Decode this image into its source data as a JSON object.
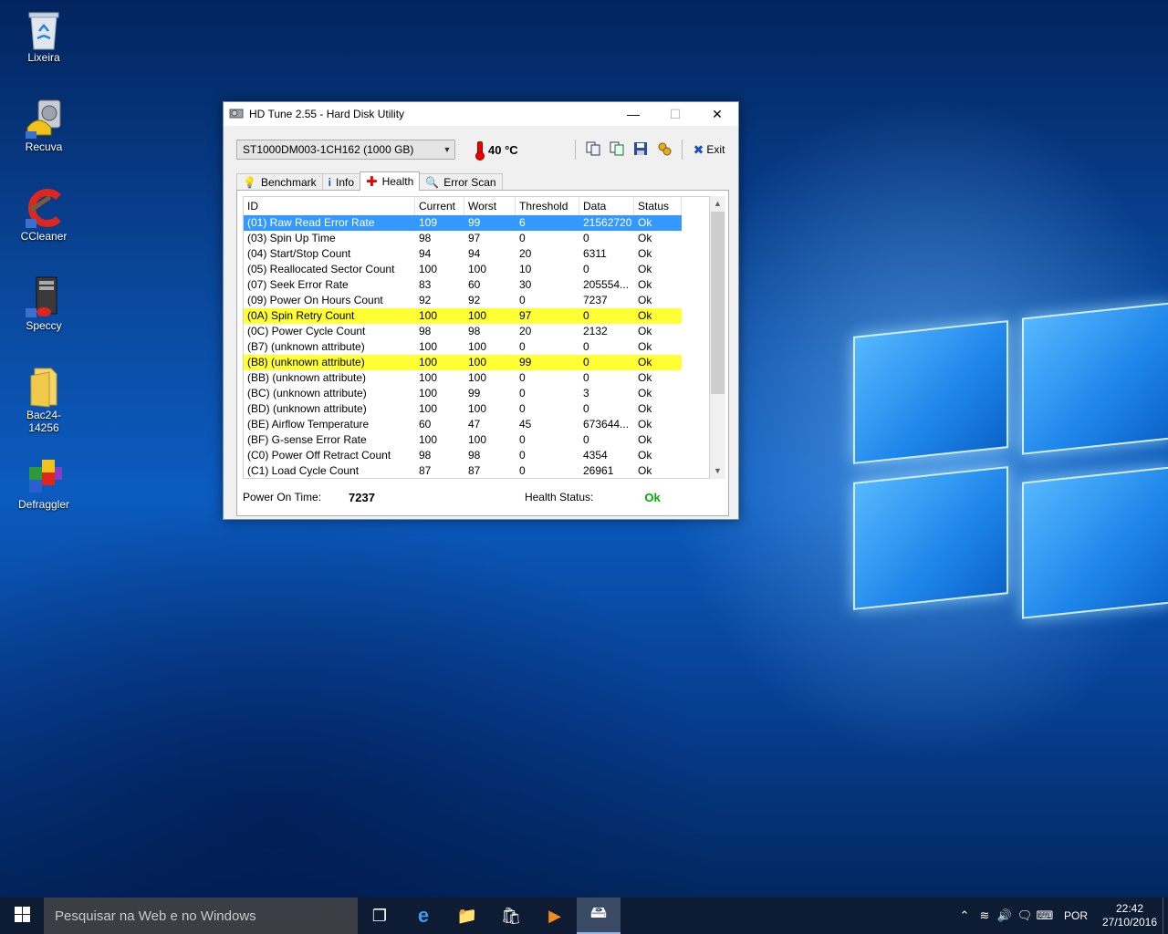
{
  "desktop": {
    "icons": [
      {
        "label": "Lixeira",
        "icon": "recycle-bin-icon"
      },
      {
        "label": "Recuva",
        "icon": "recuva-icon"
      },
      {
        "label": "CCleaner",
        "icon": "ccleaner-icon"
      },
      {
        "label": "Speccy",
        "icon": "speccy-icon"
      },
      {
        "label": "Bac24- 14256",
        "icon": "folder-icon"
      },
      {
        "label": "Defraggler",
        "icon": "defraggler-icon"
      }
    ]
  },
  "window": {
    "title": "HD Tune 2.55 - Hard Disk Utility",
    "drive": "ST1000DM003-1CH162 (1000 GB)",
    "temperature": "40 °C",
    "exit_label": "Exit",
    "tabs": [
      {
        "label": "Benchmark",
        "icon": "lightbulb-icon"
      },
      {
        "label": "Info",
        "icon": "info-icon"
      },
      {
        "label": "Health",
        "icon": "health-cross-icon",
        "active": true
      },
      {
        "label": "Error Scan",
        "icon": "magnifier-icon"
      }
    ],
    "columns": {
      "id": "ID",
      "current": "Current",
      "worst": "Worst",
      "threshold": "Threshold",
      "data": "Data",
      "status": "Status"
    },
    "rows": [
      {
        "id": "(01) Raw Read Error Rate",
        "current": "109",
        "worst": "99",
        "threshold": "6",
        "data": "21562720",
        "status": "Ok",
        "state": "selected"
      },
      {
        "id": "(03) Spin Up Time",
        "current": "98",
        "worst": "97",
        "threshold": "0",
        "data": "0",
        "status": "Ok",
        "state": ""
      },
      {
        "id": "(04) Start/Stop Count",
        "current": "94",
        "worst": "94",
        "threshold": "20",
        "data": "6311",
        "status": "Ok",
        "state": ""
      },
      {
        "id": "(05) Reallocated Sector Count",
        "current": "100",
        "worst": "100",
        "threshold": "10",
        "data": "0",
        "status": "Ok",
        "state": ""
      },
      {
        "id": "(07) Seek Error Rate",
        "current": "83",
        "worst": "60",
        "threshold": "30",
        "data": "205554...",
        "status": "Ok",
        "state": ""
      },
      {
        "id": "(09) Power On Hours Count",
        "current": "92",
        "worst": "92",
        "threshold": "0",
        "data": "7237",
        "status": "Ok",
        "state": ""
      },
      {
        "id": "(0A) Spin Retry Count",
        "current": "100",
        "worst": "100",
        "threshold": "97",
        "data": "0",
        "status": "Ok",
        "state": "warn"
      },
      {
        "id": "(0C) Power Cycle Count",
        "current": "98",
        "worst": "98",
        "threshold": "20",
        "data": "2132",
        "status": "Ok",
        "state": ""
      },
      {
        "id": "(B7) (unknown attribute)",
        "current": "100",
        "worst": "100",
        "threshold": "0",
        "data": "0",
        "status": "Ok",
        "state": ""
      },
      {
        "id": "(B8) (unknown attribute)",
        "current": "100",
        "worst": "100",
        "threshold": "99",
        "data": "0",
        "status": "Ok",
        "state": "warn"
      },
      {
        "id": "(BB) (unknown attribute)",
        "current": "100",
        "worst": "100",
        "threshold": "0",
        "data": "0",
        "status": "Ok",
        "state": ""
      },
      {
        "id": "(BC) (unknown attribute)",
        "current": "100",
        "worst": "99",
        "threshold": "0",
        "data": "3",
        "status": "Ok",
        "state": ""
      },
      {
        "id": "(BD) (unknown attribute)",
        "current": "100",
        "worst": "100",
        "threshold": "0",
        "data": "0",
        "status": "Ok",
        "state": ""
      },
      {
        "id": "(BE) Airflow Temperature",
        "current": "60",
        "worst": "47",
        "threshold": "45",
        "data": "673644...",
        "status": "Ok",
        "state": ""
      },
      {
        "id": "(BF) G-sense Error Rate",
        "current": "100",
        "worst": "100",
        "threshold": "0",
        "data": "0",
        "status": "Ok",
        "state": ""
      },
      {
        "id": "(C0) Power Off Retract Count",
        "current": "98",
        "worst": "98",
        "threshold": "0",
        "data": "4354",
        "status": "Ok",
        "state": ""
      },
      {
        "id": "(C1) Load Cycle Count",
        "current": "87",
        "worst": "87",
        "threshold": "0",
        "data": "26961",
        "status": "Ok",
        "state": ""
      }
    ],
    "power_on_label": "Power On Time:",
    "power_on_value": "7237",
    "health_label": "Health Status:",
    "health_value": "Ok"
  },
  "taskbar": {
    "search_placeholder": "Pesquisar na Web e no Windows",
    "language": "POR",
    "time": "22:42",
    "date": "27/10/2016"
  },
  "colors": {
    "selection": "#3399ff",
    "warning_row": "#ffff33",
    "health_ok": "#00b000"
  }
}
